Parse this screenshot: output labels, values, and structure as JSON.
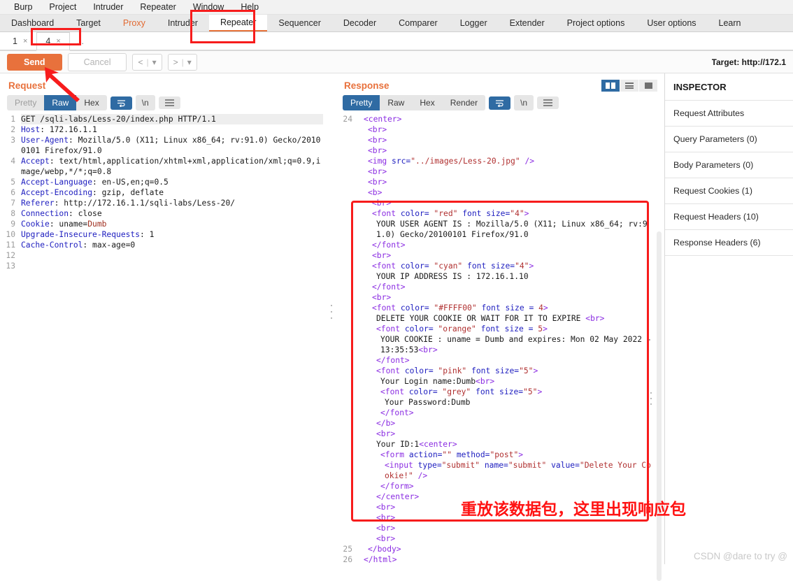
{
  "menu": {
    "items": [
      "Burp",
      "Project",
      "Intruder",
      "Repeater",
      "Window",
      "Help"
    ]
  },
  "main_tabs": {
    "items": [
      {
        "label": "Dashboard",
        "state": "normal"
      },
      {
        "label": "Target",
        "state": "normal"
      },
      {
        "label": "Proxy",
        "state": "accent"
      },
      {
        "label": "Intruder",
        "state": "normal"
      },
      {
        "label": "Repeater",
        "state": "active"
      },
      {
        "label": "Sequencer",
        "state": "normal"
      },
      {
        "label": "Decoder",
        "state": "normal"
      },
      {
        "label": "Comparer",
        "state": "normal"
      },
      {
        "label": "Logger",
        "state": "normal"
      },
      {
        "label": "Extender",
        "state": "normal"
      },
      {
        "label": "Project options",
        "state": "normal"
      },
      {
        "label": "User options",
        "state": "normal"
      },
      {
        "label": "Learn",
        "state": "normal"
      }
    ]
  },
  "sub_tabs": {
    "items": [
      {
        "label": "1",
        "close": "×",
        "active": false
      },
      {
        "label": "4",
        "close": "×",
        "active": true
      }
    ],
    "overflow": "..."
  },
  "toolbar": {
    "send_label": "Send",
    "cancel_label": "Cancel",
    "back_label": "<",
    "back_caret": "▾",
    "forward_label": ">",
    "forward_caret": "▾",
    "target_label": "Target: http://172.1"
  },
  "request": {
    "title": "Request",
    "view_tabs": [
      {
        "label": "Pretty",
        "state": "off"
      },
      {
        "label": "Raw",
        "state": "on"
      },
      {
        "label": "Hex",
        "state": "normal"
      }
    ],
    "tools": [
      "wrap-icon",
      "newline-icon",
      "menu-icon"
    ],
    "lines": [
      {
        "n": "1",
        "highlight": true,
        "segments": [
          {
            "t": "GET /sqli-labs/Less-20/index.php HTTP/1.1",
            "c": "k-txt"
          }
        ]
      },
      {
        "n": "2",
        "segments": [
          {
            "t": "Host",
            "c": "k-hdr"
          },
          {
            "t": ": 172.16.1.1",
            "c": "k-txt"
          }
        ]
      },
      {
        "n": "3",
        "segments": [
          {
            "t": "User-Agent",
            "c": "k-hdr"
          },
          {
            "t": ": Mozilla/5.0 (X11; Linux x86_64; rv:91.0) Gecko/20100101 Firefox/91.0",
            "c": "k-txt"
          }
        ]
      },
      {
        "n": "4",
        "segments": [
          {
            "t": "Accept",
            "c": "k-hdr"
          },
          {
            "t": ": text/html,application/xhtml+xml,application/xml;q=0.9,image/webp,*/*;q=0.8",
            "c": "k-txt"
          }
        ]
      },
      {
        "n": "5",
        "segments": [
          {
            "t": "Accept-Language",
            "c": "k-hdr"
          },
          {
            "t": ": en-US,en;q=0.5",
            "c": "k-txt"
          }
        ]
      },
      {
        "n": "6",
        "segments": [
          {
            "t": "Accept-Encoding",
            "c": "k-hdr"
          },
          {
            "t": ": gzip, deflate",
            "c": "k-txt"
          }
        ]
      },
      {
        "n": "7",
        "segments": [
          {
            "t": "Referer",
            "c": "k-hdr"
          },
          {
            "t": ": http://172.16.1.1/sqli-labs/Less-20/",
            "c": "k-txt"
          }
        ]
      },
      {
        "n": "8",
        "segments": [
          {
            "t": "Connection",
            "c": "k-hdr"
          },
          {
            "t": ": close",
            "c": "k-txt"
          }
        ]
      },
      {
        "n": "9",
        "segments": [
          {
            "t": "Cookie",
            "c": "k-hdr"
          },
          {
            "t": ": uname=",
            "c": "k-txt"
          },
          {
            "t": "Dumb",
            "c": "k-cookieval"
          }
        ]
      },
      {
        "n": "10",
        "segments": [
          {
            "t": "Upgrade-Insecure-Requests",
            "c": "k-hdr"
          },
          {
            "t": ": 1",
            "c": "k-txt"
          }
        ]
      },
      {
        "n": "11",
        "segments": [
          {
            "t": "Cache-Control",
            "c": "k-hdr"
          },
          {
            "t": ": max-age=0",
            "c": "k-txt"
          }
        ]
      },
      {
        "n": "12",
        "segments": []
      },
      {
        "n": "13",
        "segments": []
      }
    ]
  },
  "response": {
    "title": "Response",
    "view_tabs": [
      {
        "label": "Pretty",
        "state": "on"
      },
      {
        "label": "Raw",
        "state": "normal"
      },
      {
        "label": "Hex",
        "state": "normal"
      },
      {
        "label": "Render",
        "state": "normal"
      }
    ],
    "tools": [
      "wrap-icon",
      "newline-icon",
      "menu-icon"
    ],
    "view_modes": [
      "split-view-icon",
      "rows-view-icon",
      "single-view-icon"
    ],
    "lines": [
      {
        "n": "24",
        "indent": 1,
        "segments": [
          {
            "t": "<center>",
            "c": "k-tag"
          }
        ]
      },
      {
        "n": "",
        "indent": 2,
        "segments": [
          {
            "t": "<br>",
            "c": "k-tag"
          }
        ]
      },
      {
        "n": "",
        "indent": 2,
        "segments": [
          {
            "t": "<br>",
            "c": "k-tag"
          }
        ]
      },
      {
        "n": "",
        "indent": 2,
        "segments": [
          {
            "t": "<br>",
            "c": "k-tag"
          }
        ]
      },
      {
        "n": "",
        "indent": 2,
        "segments": [
          {
            "t": "<img ",
            "c": "k-tag"
          },
          {
            "t": "src=",
            "c": "k-attr"
          },
          {
            "t": "\"../images/Less-20.jpg\"",
            "c": "k-str"
          },
          {
            "t": " />",
            "c": "k-tag"
          }
        ]
      },
      {
        "n": "",
        "indent": 2,
        "segments": [
          {
            "t": "<br>",
            "c": "k-tag"
          }
        ]
      },
      {
        "n": "",
        "indent": 2,
        "segments": [
          {
            "t": "<br>",
            "c": "k-tag"
          }
        ]
      },
      {
        "n": "",
        "indent": 2,
        "segments": [
          {
            "t": "<b>",
            "c": "k-tag"
          }
        ]
      },
      {
        "n": "",
        "indent": 3,
        "segments": [
          {
            "t": "<br>",
            "c": "k-tag"
          }
        ]
      },
      {
        "n": "",
        "indent": 3,
        "segments": [
          {
            "t": "<font ",
            "c": "k-tag"
          },
          {
            "t": "color=",
            "c": "k-attr"
          },
          {
            "t": " \"red\"",
            "c": "k-str"
          },
          {
            "t": " font size=",
            "c": "k-attr"
          },
          {
            "t": "\"4\"",
            "c": "k-str"
          },
          {
            "t": ">",
            "c": "k-tag"
          }
        ]
      },
      {
        "n": "",
        "indent": 4,
        "segments": [
          {
            "t": "YOUR USER AGENT IS : Mozilla/5.0 (X11; Linux x86_64; rv:91.0) Gecko/20100101 Firefox/91.0",
            "c": "k-txt"
          }
        ]
      },
      {
        "n": "",
        "indent": 3,
        "segments": [
          {
            "t": "</font>",
            "c": "k-tag"
          }
        ]
      },
      {
        "n": "",
        "indent": 3,
        "segments": [
          {
            "t": "<br>",
            "c": "k-tag"
          }
        ]
      },
      {
        "n": "",
        "indent": 3,
        "segments": [
          {
            "t": "<font ",
            "c": "k-tag"
          },
          {
            "t": "color=",
            "c": "k-attr"
          },
          {
            "t": " \"cyan\"",
            "c": "k-str"
          },
          {
            "t": " font size=",
            "c": "k-attr"
          },
          {
            "t": "\"4\"",
            "c": "k-str"
          },
          {
            "t": ">",
            "c": "k-tag"
          }
        ]
      },
      {
        "n": "",
        "indent": 4,
        "segments": [
          {
            "t": "YOUR IP ADDRESS IS : 172.16.1.10",
            "c": "k-txt"
          }
        ]
      },
      {
        "n": "",
        "indent": 3,
        "segments": [
          {
            "t": "</font>",
            "c": "k-tag"
          }
        ]
      },
      {
        "n": "",
        "indent": 3,
        "segments": [
          {
            "t": "<br>",
            "c": "k-tag"
          }
        ]
      },
      {
        "n": "",
        "indent": 3,
        "segments": [
          {
            "t": "<font ",
            "c": "k-tag"
          },
          {
            "t": "color=",
            "c": "k-attr"
          },
          {
            "t": " \"#FFFF00\"",
            "c": "k-str"
          },
          {
            "t": " font size = ",
            "c": "k-attr"
          },
          {
            "t": "4",
            "c": "k-str"
          },
          {
            "t": ">",
            "c": "k-tag"
          }
        ]
      },
      {
        "n": "",
        "indent": 4,
        "segments": [
          {
            "t": "DELETE YOUR COOKIE OR WAIT FOR IT TO EXPIRE ",
            "c": "k-txt"
          },
          {
            "t": "<br>",
            "c": "k-tag"
          }
        ]
      },
      {
        "n": "",
        "indent": 4,
        "segments": [
          {
            "t": "<font ",
            "c": "k-tag"
          },
          {
            "t": "color=",
            "c": "k-attr"
          },
          {
            "t": " \"orange\"",
            "c": "k-str"
          },
          {
            "t": " font size = ",
            "c": "k-attr"
          },
          {
            "t": "5",
            "c": "k-str"
          },
          {
            "t": ">",
            "c": "k-tag"
          }
        ]
      },
      {
        "n": "",
        "indent": 5,
        "segments": [
          {
            "t": "YOUR COOKIE : uname = Dumb and expires: Mon 02 May 2022 - 13:35:53",
            "c": "k-txt"
          },
          {
            "t": "<br>",
            "c": "k-tag"
          }
        ]
      },
      {
        "n": "",
        "indent": 4,
        "segments": [
          {
            "t": "</font>",
            "c": "k-tag"
          }
        ]
      },
      {
        "n": "",
        "indent": 4,
        "segments": [
          {
            "t": "<font ",
            "c": "k-tag"
          },
          {
            "t": "color=",
            "c": "k-attr"
          },
          {
            "t": " \"pink\"",
            "c": "k-str"
          },
          {
            "t": " font size=",
            "c": "k-attr"
          },
          {
            "t": "\"5\"",
            "c": "k-str"
          },
          {
            "t": ">",
            "c": "k-tag"
          }
        ]
      },
      {
        "n": "",
        "indent": 5,
        "segments": [
          {
            "t": "Your Login name:Dumb",
            "c": "k-txt"
          },
          {
            "t": "<br>",
            "c": "k-tag"
          }
        ]
      },
      {
        "n": "",
        "indent": 5,
        "segments": [
          {
            "t": "<font ",
            "c": "k-tag"
          },
          {
            "t": "color=",
            "c": "k-attr"
          },
          {
            "t": " \"grey\"",
            "c": "k-str"
          },
          {
            "t": " font size=",
            "c": "k-attr"
          },
          {
            "t": "\"5\"",
            "c": "k-str"
          },
          {
            "t": ">",
            "c": "k-tag"
          }
        ]
      },
      {
        "n": "",
        "indent": 6,
        "segments": [
          {
            "t": "Your Password:Dumb",
            "c": "k-txt"
          }
        ]
      },
      {
        "n": "",
        "indent": 5,
        "segments": [
          {
            "t": "</font>",
            "c": "k-tag"
          }
        ]
      },
      {
        "n": "",
        "indent": 4,
        "segments": [
          {
            "t": "</b>",
            "c": "k-tag"
          }
        ]
      },
      {
        "n": "",
        "indent": 4,
        "segments": [
          {
            "t": "<br>",
            "c": "k-tag"
          }
        ]
      },
      {
        "n": "",
        "indent": 4,
        "segments": [
          {
            "t": "Your ID:1",
            "c": "k-txt"
          },
          {
            "t": "<center>",
            "c": "k-tag"
          }
        ]
      },
      {
        "n": "",
        "indent": 5,
        "segments": [
          {
            "t": "<form ",
            "c": "k-tag"
          },
          {
            "t": "action=",
            "c": "k-attr"
          },
          {
            "t": "\"\"",
            "c": "k-str"
          },
          {
            "t": " method=",
            "c": "k-attr"
          },
          {
            "t": "\"post\"",
            "c": "k-str"
          },
          {
            "t": ">",
            "c": "k-tag"
          }
        ]
      },
      {
        "n": "",
        "indent": 6,
        "segments": [
          {
            "t": "<input ",
            "c": "k-tag"
          },
          {
            "t": "type=",
            "c": "k-attr"
          },
          {
            "t": "\"submit\"",
            "c": "k-str"
          },
          {
            "t": " name=",
            "c": "k-attr"
          },
          {
            "t": "\"submit\"",
            "c": "k-str"
          },
          {
            "t": " value=",
            "c": "k-attr"
          },
          {
            "t": "\"Delete Your Cookie!\"",
            "c": "k-str"
          },
          {
            "t": " />",
            "c": "k-tag"
          }
        ]
      },
      {
        "n": "",
        "indent": 5,
        "segments": [
          {
            "t": "</form>",
            "c": "k-tag"
          }
        ]
      },
      {
        "n": "",
        "indent": 4,
        "segments": [
          {
            "t": "</center>",
            "c": "k-tag"
          }
        ]
      },
      {
        "n": "",
        "indent": 4,
        "segments": [
          {
            "t": "<br>",
            "c": "k-tag"
          }
        ]
      },
      {
        "n": "",
        "indent": 4,
        "segments": [
          {
            "t": "<br>",
            "c": "k-tag"
          }
        ]
      },
      {
        "n": "",
        "indent": 4,
        "segments": [
          {
            "t": "<br>",
            "c": "k-tag"
          }
        ]
      },
      {
        "n": "",
        "indent": 4,
        "segments": [
          {
            "t": "<br>",
            "c": "k-tag"
          }
        ]
      },
      {
        "n": "25",
        "indent": 2,
        "segments": [
          {
            "t": "</body>",
            "c": "k-tag"
          }
        ]
      },
      {
        "n": "26",
        "indent": 1,
        "segments": [
          {
            "t": "</html>",
            "c": "k-tag"
          }
        ]
      }
    ]
  },
  "inspector": {
    "title": "INSPECTOR",
    "rows": [
      "Request Attributes",
      "Query Parameters (0)",
      "Body Parameters (0)",
      "Request Cookies (1)",
      "Request Headers (10)",
      "Response Headers (6)"
    ]
  },
  "annotations": {
    "note_text": "重放该数据包，这里出现响应包",
    "highlight_color": "#f71c1c"
  },
  "watermark": {
    "text": "CSDN @dare to try @"
  }
}
